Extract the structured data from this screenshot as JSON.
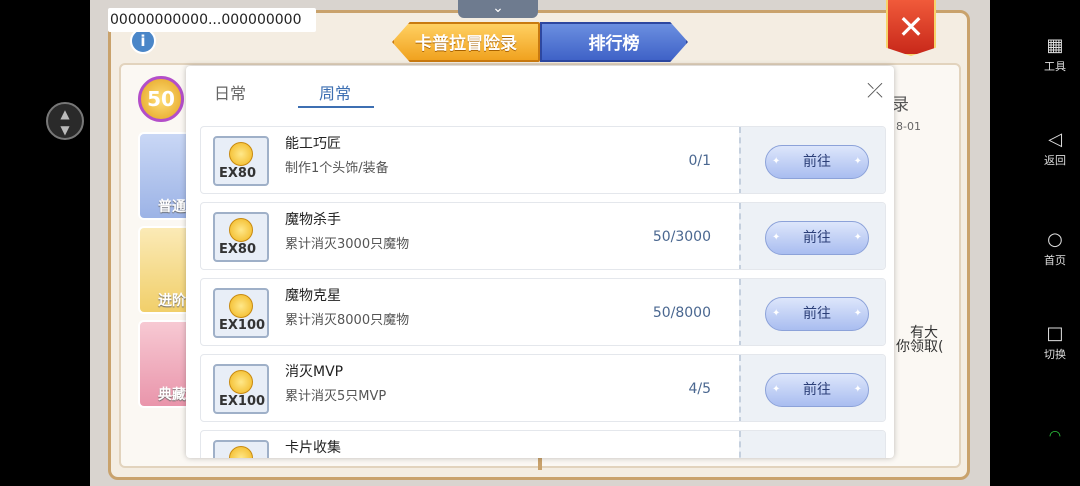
{
  "debug_text": "00000000000...000000000",
  "top_tabs": {
    "adventure": "卡普拉冒险录",
    "rank": "排行榜"
  },
  "level": "50",
  "categories": {
    "normal": "普通",
    "advanced": "进阶",
    "collection": "典藏"
  },
  "right_panel": {
    "title": "录",
    "date": "8-01",
    "text1": "有大",
    "text2": "你领取("
  },
  "dialog": {
    "tabs": {
      "daily": "日常",
      "weekly": "周常"
    },
    "selected_tab": "weekly",
    "tasks": [
      {
        "title": "能工巧匠",
        "desc": "制作1个头饰/装备",
        "progress": "0/1",
        "badge": "EX80",
        "action": "前往"
      },
      {
        "title": "魔物杀手",
        "desc": "累计消灭3000只魔物",
        "progress": "50/3000",
        "badge": "EX80",
        "action": "前往"
      },
      {
        "title": "魔物克星",
        "desc": "累计消灭8000只魔物",
        "progress": "50/8000",
        "badge": "EX100",
        "action": "前往"
      },
      {
        "title": "消灭MVP",
        "desc": "累计消灭5只MVP",
        "progress": "4/5",
        "badge": "EX100",
        "action": "前往"
      },
      {
        "title": "卡片收集",
        "desc": "",
        "progress": "",
        "badge": "",
        "action": ""
      }
    ]
  },
  "sidebar": {
    "tools": "工具",
    "back": "返回",
    "home": "首页",
    "switch": "切换"
  },
  "icons": {
    "close": "close-icon",
    "info": "info-icon",
    "down": "chevron-down-icon",
    "scroll": "scroll-toggle-icon"
  },
  "colors": {
    "accent_blue": "#3d6fb2",
    "close_red": "#c8281a",
    "tab_gold": "#f0a21f"
  }
}
